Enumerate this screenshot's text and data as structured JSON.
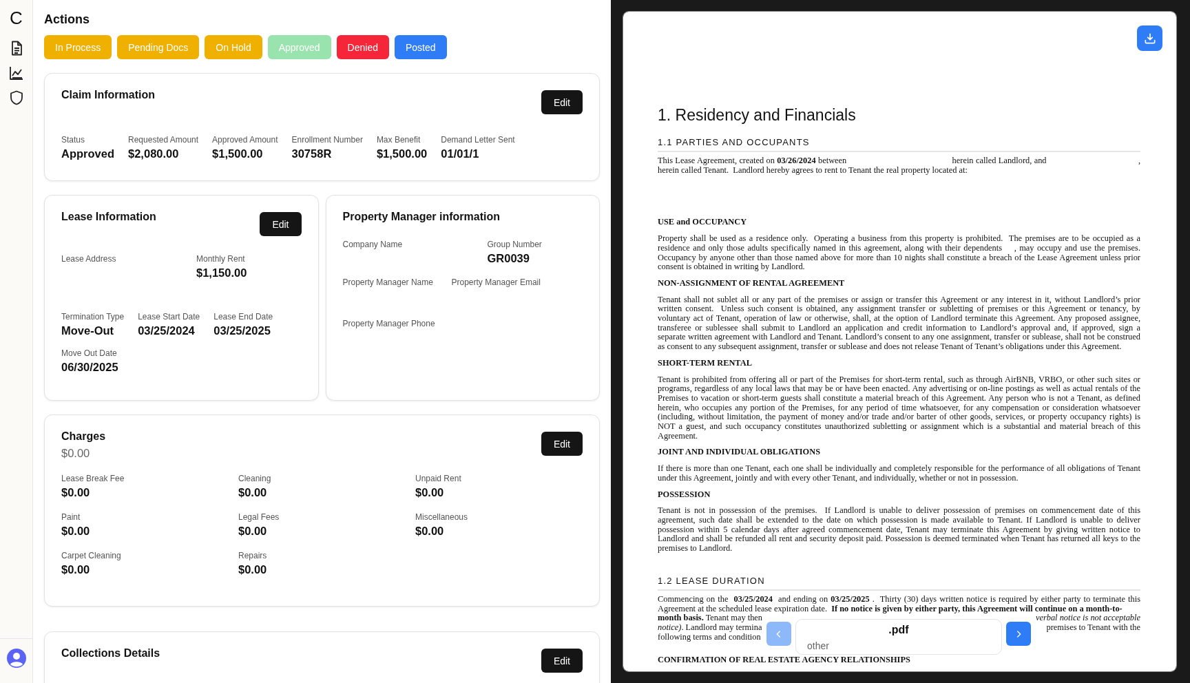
{
  "sidebar": {
    "logo": "C",
    "items": [
      {
        "kind": "document"
      },
      {
        "kind": "chart"
      },
      {
        "kind": "shield"
      }
    ]
  },
  "actions": {
    "title": "Actions",
    "buttons": [
      {
        "label": "In Process",
        "color": "#f0b000"
      },
      {
        "label": "Pending Docs",
        "color": "#f0b000"
      },
      {
        "label": "On Hold",
        "color": "#f0b000"
      },
      {
        "label": "Approved",
        "color": "#98e3ae"
      },
      {
        "label": "Denied",
        "color": "#f5253a"
      },
      {
        "label": "Posted",
        "color": "#2f7df6"
      }
    ]
  },
  "claim": {
    "title": "Claim Information",
    "edit": "Edit",
    "fields": [
      {
        "label": "Status",
        "value": "Approved"
      },
      {
        "label": "Requested Amount",
        "value": "$2,080.00"
      },
      {
        "label": "Approved Amount",
        "value": "$1,500.00"
      },
      {
        "label": "Enrollment Number",
        "value": "30758R"
      },
      {
        "label": "Max Benefit",
        "value": "$1,500.00"
      },
      {
        "label": "Demand Letter Sent",
        "value": "01/01/1"
      }
    ]
  },
  "lease": {
    "title": "Lease Information",
    "edit": "Edit",
    "address_fields": [
      {
        "label": "Lease Address"
      },
      {
        "label": "Monthly Rent",
        "value": "$1,150.00"
      }
    ],
    "term_fields": [
      {
        "label": "Termination Type",
        "value": "Move-Out"
      },
      {
        "label": "Lease Start Date",
        "value": "03/25/2024"
      },
      {
        "label": "Lease End Date",
        "value": "03/25/2025"
      }
    ],
    "move_out": {
      "label": "Move Out Date",
      "value": "06/30/2025"
    }
  },
  "property_manager": {
    "title": "Property Manager information",
    "rows": [
      [
        {
          "label": "Company Name"
        },
        {
          "label": "Group Number",
          "value": "GR0039"
        }
      ],
      [
        {
          "label": "Property Manager Name"
        },
        {
          "label": "Property Manager Email"
        }
      ],
      [
        {
          "label": "Property Manager Phone"
        }
      ]
    ]
  },
  "charges": {
    "title": "Charges",
    "total": "$0.00",
    "edit": "Edit",
    "fields": [
      {
        "label": "Lease Break Fee",
        "value": "$0.00"
      },
      {
        "label": "Cleaning",
        "value": "$0.00"
      },
      {
        "label": "Unpaid Rent",
        "value": "$0.00"
      },
      {
        "label": "Paint",
        "value": "$0.00"
      },
      {
        "label": "Legal Fees",
        "value": "$0.00"
      },
      {
        "label": "Miscellaneous",
        "value": "$0.00"
      },
      {
        "label": "Carpet Cleaning",
        "value": "$0.00"
      },
      {
        "label": "Repairs",
        "value": "$0.00"
      }
    ]
  },
  "collections": {
    "title": "Collections Details",
    "edit": "Edit"
  },
  "document": {
    "blocks": [
      {
        "kind": "title",
        "text": "1. Residency and Financials"
      },
      {
        "kind": "section",
        "text": "1.1  PARTIES AND OCCUPANTS"
      },
      {
        "kind": "para",
        "text": "This Lease Agreement, created on **03/26/2024** between                                              herein called Landlord, and                                        , herein called Tenant.  Landlord hereby agrees to rent to Tenant the real property located at:"
      },
      {
        "kind": "spacer"
      },
      {
        "kind": "heading",
        "text": "USE and OCCUPANCY"
      },
      {
        "kind": "para",
        "text": "Property shall be used as a residence only.  Operating a business from this property is prohibited.  The premises are to be occupied as a residence and only those adults specifically named in this agreement, along with their dependents    , may occupy and use the premises.  Occupancy by anyone other than those named above for more than 10 nights shall constitute a breach of the Lease Agreement unless prior consent is obtained in writing by Landlord."
      },
      {
        "kind": "heading",
        "text": "NON-ASSIGNMENT OF RENTAL AGREEMENT"
      },
      {
        "kind": "para",
        "text": "Tenant shall not sublet all or any part of the premises or assign or transfer this Agreement or any interest in it, without Landlord’s prior written consent.  Unless such consent is obtained, any assignment transfer or subletting of premises or this Agreement or tenancy, by voluntary act of Tenant, operation of law or otherwise, shall, at the option of Landlord terminate this Agreement. Any proposed assignee, transferee or sublessee shall submit to Landlord an application and credit information to Landlord’s approval and, if approved, sign a separate written agreement with Landlord and Tenant. Landlord’s consent to any one assignment, transfer or sublease, shall not be construed as consent to any subsequent assignment, transfer or sublease and does not release Tenant of Tenant’s obligations under this Agreement."
      },
      {
        "kind": "heading",
        "text": "SHORT-TERM RENTAL"
      },
      {
        "kind": "para",
        "text": "Tenant is prohibited from offering all or part of the Premises for short-term rental, such as through AirBNB, VRBO, or other such sites or programs, regardless of any local laws that may be or have been enacted. Any advertising or on-line postings as well as actual rentals of the Premises to vacation or short-term guests shall constitute a material breach of this Agreement. Any person who is not a Tenant, as defined herein, who occupies any portion of the Premises, for any period of time whatsoever, for any compensation or consideration whatsoever (including, without limitation, the payment of money and/or trade and/or barter of other goods, services, or property occupancy rights) is NOT a guest, and such occupancy constitutes unauthorized subletting or assignment which is a substantial and material breach of this Agreement."
      },
      {
        "kind": "heading",
        "text": "JOINT AND INDIVIDUAL OBLIGATIONS"
      },
      {
        "kind": "para",
        "text": "If there is more than one Tenant, each one shall be individually and completely responsible for the performance of all obligations of Tenant under this Agreement, jointly and with every other Tenant, and individually, whether or not in possession."
      },
      {
        "kind": "heading",
        "text": "POSSESSION"
      },
      {
        "kind": "para",
        "text": "Tenant is not in possession of the premises.  If Landlord is unable to deliver possession of premises on commencement date of this agreement, such date shall be extended to the date on which possession is made available to Tenant. If Landlord is unable to deliver possession within 5 calendar days after agreed commencement date, Tenant may terminate this Agreement by giving written notice to Landlord and shall be refunded all rent and security deposit paid. Possession is deemed terminated when Tenant has returned all keys to the premises to Landlord."
      },
      {
        "kind": "section",
        "text": "1.2  LEASE DURATION"
      },
      {
        "kind": "para",
        "text": "Commencing on the  **03/25/2024**  and ending on **03/25/2025** .  Thirty (30) days written notice is required by either party to terminate this Agreement at the scheduled lease expiration date.  **If no notice is given by either party, this Agreement will continue on a month-to-**"
      },
      {
        "kind": "partial",
        "left": "**month basis.** Tenant may then",
        "right": "*verbal notice is not acceptable*"
      },
      {
        "kind": "partial",
        "left": "*notice)*. Landlord may termina",
        "right": "premises to Tenant with the"
      },
      {
        "kind": "partial",
        "left": "following terms and condition"
      },
      {
        "kind": "spacer"
      },
      {
        "kind": "heading",
        "text": "CONFIRMATION OF REAL ESTATE AGENCY RELATIONSHIPS"
      }
    ],
    "file": {
      "name": ".pdf",
      "type": "other"
    }
  }
}
